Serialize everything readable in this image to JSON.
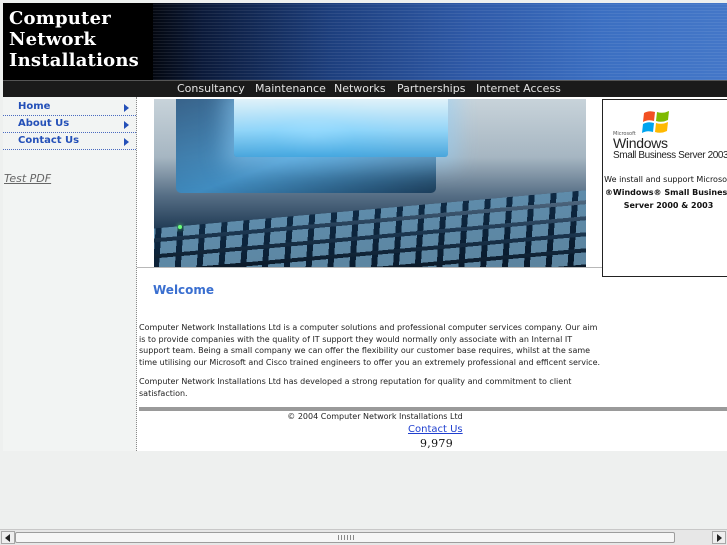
{
  "header": {
    "logo_lines": [
      "Computer",
      "Network",
      "Installations"
    ]
  },
  "topnav": {
    "items": [
      "Consultancy",
      "Maintenance",
      "Networks",
      "Partnerships",
      "Internet Access"
    ]
  },
  "sidenav": {
    "items": [
      "Home",
      "About Us",
      "Contact Us"
    ],
    "link": "Test PDF"
  },
  "ad": {
    "brand_small": "Microsoft",
    "brand_windows": "Windows",
    "brand_product": "Small Business Server 2003",
    "line1": "We install and support Microsoft",
    "line2": "®Windows® Small Business",
    "line3": "Server 2000 & 2003"
  },
  "main": {
    "heading": "Welcome",
    "paragraphs": [
      "Computer Network Installations Ltd is a computer solutions and professional computer services company. Our aim is to provide companies with the quality of IT support they would normally only associate with an Internal IT support team. Being a small company we can offer the flexibility our customer base requires, whilst at the same time utilising our Microsoft and Cisco trained engineers to offer you an extremely professional and efficent service.",
      "Computer Network Installations Ltd has developed a strong reputation for quality and commitment to client satisfaction."
    ]
  },
  "footer": {
    "copyright": "© 2004 Computer Network Installations Ltd",
    "contact_link": "Contact Us",
    "counter": "9,979"
  },
  "colors": {
    "nav_link": "#2450b8",
    "heading": "#3a6fd0",
    "link": "#1f3fcf"
  }
}
